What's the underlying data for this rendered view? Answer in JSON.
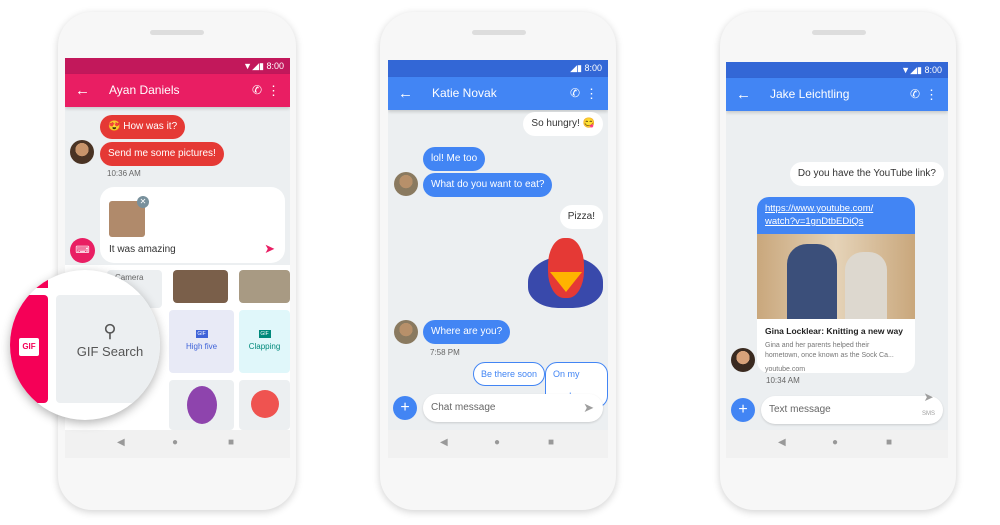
{
  "status_time": "8:00",
  "phone1": {
    "contact": "Ayan Daniels",
    "messages": [
      {
        "text": "How was it?",
        "emoji": "😍"
      },
      {
        "text": "Send me some pictures!"
      }
    ],
    "time": "10:36 AM",
    "compose_text": "It was amazing",
    "grid": {
      "camera_label": "Camera",
      "gif_search": "GIF Search",
      "gif_badge": "GIF",
      "high_five": "High five",
      "clapping": "Clapping"
    },
    "colors": {
      "status": "#c2185b",
      "appbar": "#e91e63",
      "bubble": "#e53935"
    }
  },
  "phone2": {
    "contact": "Katie Novak",
    "messages": [
      {
        "text": "So hungry! 😋",
        "dir": "out"
      },
      {
        "text": "lol! Me too",
        "dir": "in"
      },
      {
        "text": "What do you want to eat?",
        "dir": "in"
      },
      {
        "text": "Pizza!",
        "dir": "out"
      },
      {
        "text": "Where are you?",
        "dir": "in"
      }
    ],
    "time": "7:58 PM",
    "suggestions": [
      "Be there soon",
      "On my way!"
    ],
    "compose_placeholder": "Chat message",
    "colors": {
      "status": "#3367d6",
      "appbar": "#4285f4"
    }
  },
  "phone3": {
    "contact": "Jake Leichtling",
    "out_message": "Do you have the YouTube link?",
    "link": {
      "url_line1": "https://www.youtube.com/",
      "url_line2": "watch?v=1gnDtbEDiQs",
      "title": "Gina Locklear: Knitting a new way",
      "desc_line1": "Gina and her parents helped their",
      "desc_line2": "hometown, once known as the Sock Ca...",
      "domain": "youtube.com"
    },
    "time": "10:34 AM",
    "compose_placeholder": "Text message",
    "send_sub": "SMS"
  }
}
